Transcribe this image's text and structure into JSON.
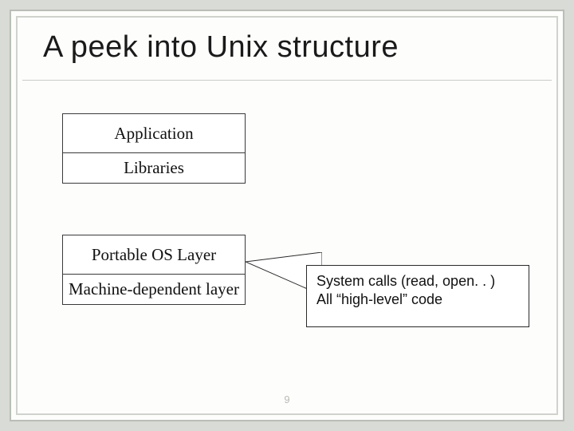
{
  "slide": {
    "title": "A peek into Unix structure",
    "page_number": "9"
  },
  "layers": {
    "application": "Application",
    "libraries": "Libraries",
    "portable_os": "Portable OS Layer",
    "machine_dependent": "Machine-dependent layer"
  },
  "callout": {
    "line1": "System calls (read, open. . )",
    "line2": "All “high-level” code"
  }
}
